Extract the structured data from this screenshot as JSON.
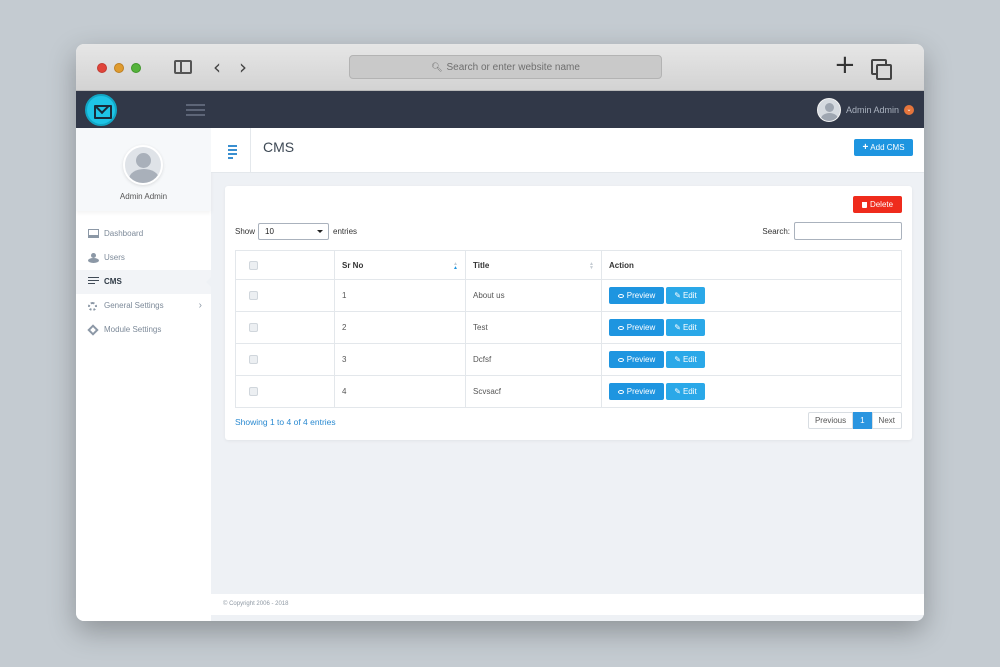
{
  "browser": {
    "address_placeholder": "Search or enter website name"
  },
  "topbar": {
    "user_name": "Admin Admin"
  },
  "sidebar": {
    "profile_name": "Admin Admin",
    "items": [
      {
        "label": "Dashboard",
        "icon": "monitor-icon"
      },
      {
        "label": "Users",
        "icon": "users-icon"
      },
      {
        "label": "CMS",
        "icon": "list-icon",
        "active": true
      },
      {
        "label": "General Settings",
        "icon": "gear-icon"
      },
      {
        "label": "Module Settings",
        "icon": "cube-icon"
      }
    ]
  },
  "header": {
    "title": "CMS",
    "add_button": "Add CMS"
  },
  "card": {
    "delete_button": "Delete",
    "show_label": "Show",
    "entries_value": "10",
    "entries_label": "entries",
    "search_label": "Search:",
    "columns": [
      "Sr No",
      "Title",
      "Action"
    ],
    "rows": [
      {
        "sr": "1",
        "title": "About us"
      },
      {
        "sr": "2",
        "title": "Test"
      },
      {
        "sr": "3",
        "title": "Dcfsf"
      },
      {
        "sr": "4",
        "title": "Scvsacf"
      }
    ],
    "preview_label": "Preview",
    "edit_label": "Edit",
    "info": "Showing 1 to 4 of 4 entries",
    "pagination": {
      "previous": "Previous",
      "current": "1",
      "next": "Next"
    }
  },
  "footer": {
    "copyright": "© Copyright 2006 - 2018"
  },
  "colors": {
    "topbar": "#313848",
    "accent": "#1e95e0",
    "delete": "#ef2b1c",
    "logo": "#1ec4e6"
  }
}
